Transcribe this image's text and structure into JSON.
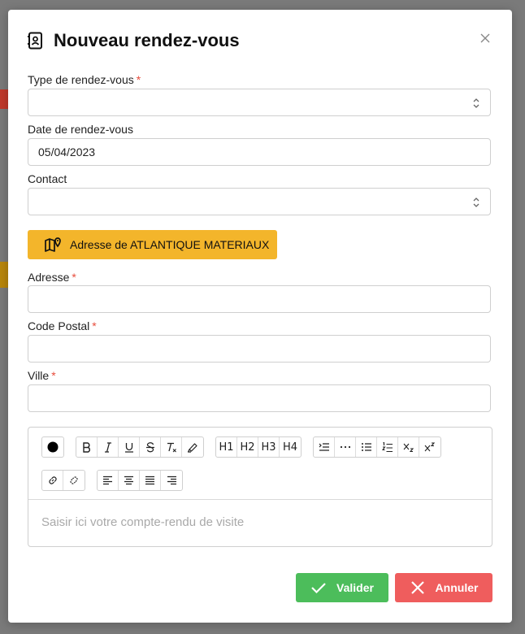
{
  "modal": {
    "title": "Nouveau rendez-vous",
    "close_symbol": "×"
  },
  "form": {
    "type_label": "Type de rendez-vous",
    "type_value": "",
    "date_label": "Date de rendez-vous",
    "date_value": "05/04/2023",
    "contact_label": "Contact",
    "contact_value": "",
    "address_button_label": "Adresse de ATLANTIQUE MATERIAUX",
    "adresse_label": "Adresse",
    "adresse_value": "",
    "code_postal_label": "Code Postal",
    "code_postal_value": "",
    "ville_label": "Ville",
    "ville_value": "",
    "required_mark": "*"
  },
  "editor": {
    "placeholder": "Saisir ici votre compte-rendu de visite",
    "headings": [
      "H1",
      "H2",
      "H3",
      "H4"
    ]
  },
  "actions": {
    "validate_label": "Valider",
    "cancel_label": "Annuler"
  },
  "colors": {
    "accent_yellow": "#f3b52b",
    "validate_green": "#4cbd5b",
    "cancel_red": "#ef5d5d",
    "required_red": "#e74c3c"
  }
}
